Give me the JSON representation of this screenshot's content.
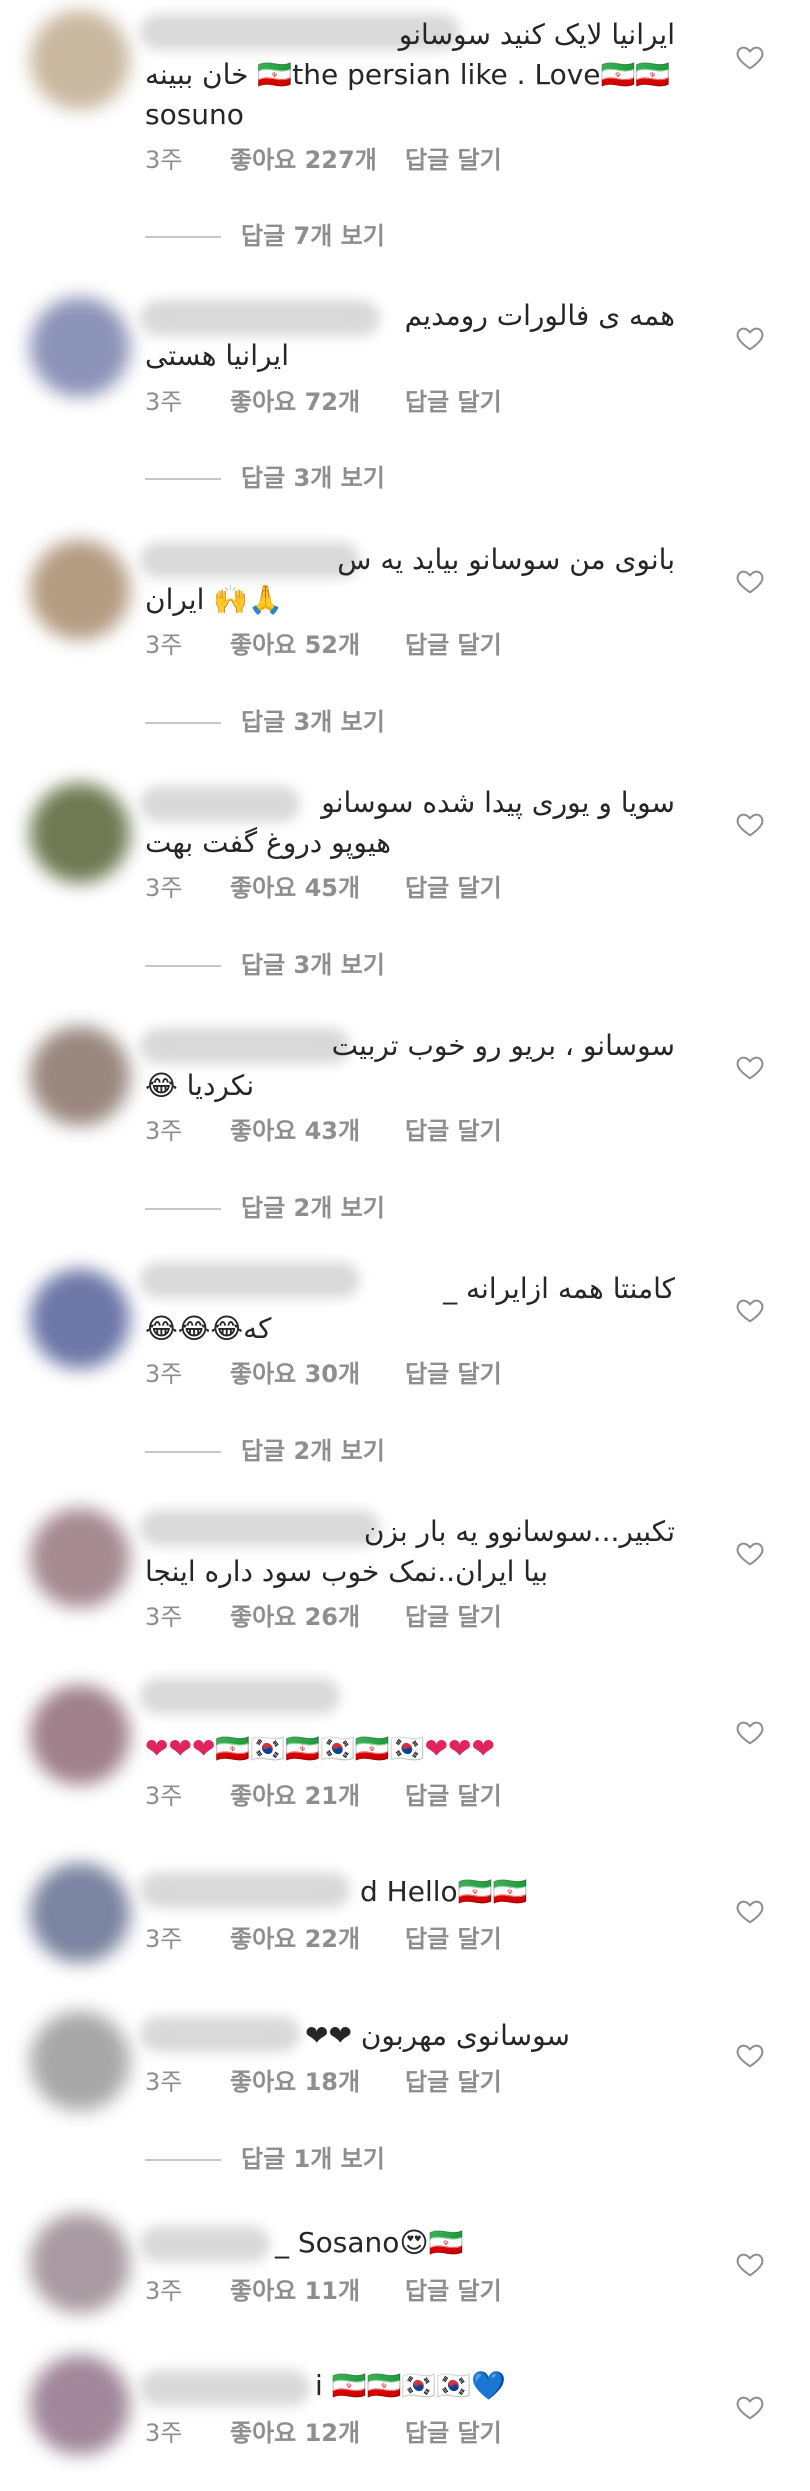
{
  "comments": [
    {
      "avatar_color": "#c9b8a0",
      "line1": "ایرانیا لایک کنید سوسانو",
      "line2": "خان ببینه 🇮🇷the persian like . Love🇮🇷🇮🇷",
      "line3": "sosuno",
      "time": "3주",
      "likes": "좋아요 227개",
      "reply": "답글 달기",
      "view_replies": "답글 7개 보기"
    },
    {
      "avatar_color": "#8c93b8",
      "line1": "همه ی فالورات رومدیم",
      "line2": "ایرانیا هستی",
      "time": "3주",
      "likes": "좋아요 72개",
      "reply": "답글 달기",
      "view_replies": "답글 3개 보기"
    },
    {
      "avatar_color": "#b49c82",
      "line1": "بانوی من سوسانو بیاید یه س",
      "line2": "ایران 🙌🙏",
      "time": "3주",
      "likes": "좋아요 52개",
      "reply": "답글 달기",
      "view_replies": "답글 3개 보기"
    },
    {
      "avatar_color": "#6f7a52",
      "line1": "سویا و یوری پیدا شده سوسانو",
      "line2": "هیوپو دروغ گفت بهت",
      "time": "3주",
      "likes": "좋아요 45개",
      "reply": "답글 달기",
      "view_replies": "답글 3개 보기"
    },
    {
      "avatar_color": "#9a8880",
      "line1": "سوسانو ، بریو رو خوب تربیت",
      "line2": "نکردیا 😂",
      "time": "3주",
      "likes": "좋아요 43개",
      "reply": "답글 달기",
      "view_replies": "답글 2개 보기"
    },
    {
      "avatar_color": "#6e78a8",
      "line1": "کامنتا همه ازایرانه _",
      "line2": "که😂😂😂",
      "time": "3주",
      "likes": "좋아요 30개",
      "reply": "답글 달기",
      "view_replies": "답글 2개 보기"
    },
    {
      "avatar_color": "#a58a92",
      "line1": "تکبیر...سوسانوو یه بار بزن",
      "line2": "بیا ایران..نمک خوب سود داره اینجا",
      "time": "3주",
      "likes": "좋아요 26개",
      "reply": "답글 달기"
    },
    {
      "avatar_color": "#a0808a",
      "line1": "❤❤❤🇮🇷🇰🇷🇮🇷🇰🇷🇮🇷🇰🇷❤❤❤",
      "time": "3주",
      "likes": "좋아요 21개",
      "reply": "답글 달기"
    },
    {
      "avatar_color": "#7b84a0",
      "line1": "d Hello🇮🇷🇮🇷",
      "time": "3주",
      "likes": "좋아요 22개",
      "reply": "답글 달기"
    },
    {
      "avatar_color": "#a8a8a8",
      "line1": "سوسانوی مهربون ❤❤",
      "time": "3주",
      "likes": "좋아요 18개",
      "reply": "답글 달기",
      "view_replies": "답글 1개 보기"
    },
    {
      "avatar_color": "#a89aa0",
      "line1": "_ Sosano😍🇮🇷",
      "time": "3주",
      "likes": "좋아요 11개",
      "reply": "답글 달기"
    },
    {
      "avatar_color": "#a0889a",
      "line1": "i 🇮🇷🇮🇷🇰🇷🇰🇷💙",
      "time": "3주",
      "likes": "좋아요 12개",
      "reply": "답글 달기"
    }
  ]
}
